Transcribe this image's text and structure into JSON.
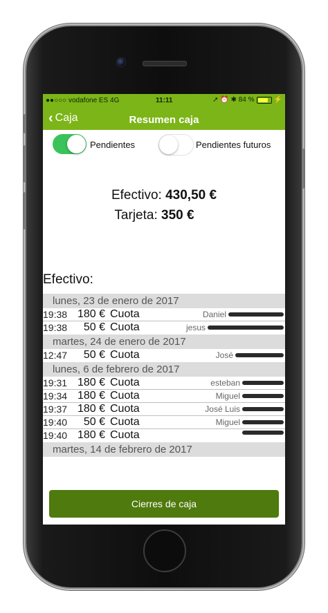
{
  "status_bar": {
    "carrier": "●●○○○ vodafone ES  4G",
    "time": "11:11",
    "indicators": "➚ ⏰ ✱ 84 %",
    "battery_level": 0.84
  },
  "nav": {
    "back_label": "Caja",
    "title": "Resumen caja"
  },
  "toggles": [
    {
      "label": "Pendientes",
      "on": true
    },
    {
      "label": "Pendientes futuros",
      "on": false
    }
  ],
  "totals": {
    "efectivo_label": "Efectivo:",
    "efectivo_value": "430,50 €",
    "tarjeta_label": "Tarjeta:",
    "tarjeta_value": "350 €"
  },
  "section_title": "Efectivo:",
  "days": [
    {
      "date": "lunes, 23 de enero de 2017",
      "rows": [
        {
          "time": "19:38",
          "amount": "180 €",
          "concept": "Cuota",
          "name": "Daniel"
        },
        {
          "time": "19:38",
          "amount": "50 €",
          "concept": "Cuota",
          "name": "jesus"
        }
      ]
    },
    {
      "date": "martes, 24 de enero de 2017",
      "rows": [
        {
          "time": "12:47",
          "amount": "50 €",
          "concept": "Cuota",
          "name": "José"
        }
      ]
    },
    {
      "date": "lunes, 6 de febrero de 2017",
      "rows": [
        {
          "time": "19:31",
          "amount": "180 €",
          "concept": "Cuota",
          "name": "esteban"
        },
        {
          "time": "19:34",
          "amount": "180 €",
          "concept": "Cuota",
          "name": "Miguel"
        },
        {
          "time": "19:37",
          "amount": "180 €",
          "concept": "Cuota",
          "name": "José Luis"
        },
        {
          "time": "19:40",
          "amount": "50 €",
          "concept": "Cuota",
          "name": "Miguel"
        },
        {
          "time": "19:40",
          "amount": "180 €",
          "concept": "Cuota",
          "name": ""
        }
      ]
    },
    {
      "date": "martes, 14 de febrero de 2017",
      "rows": []
    }
  ],
  "footer_button": "Cierres de caja",
  "colors": {
    "accent_green": "#7cb518",
    "switch_on": "#3ac35a",
    "button_dark_green": "#4f7a0e"
  }
}
